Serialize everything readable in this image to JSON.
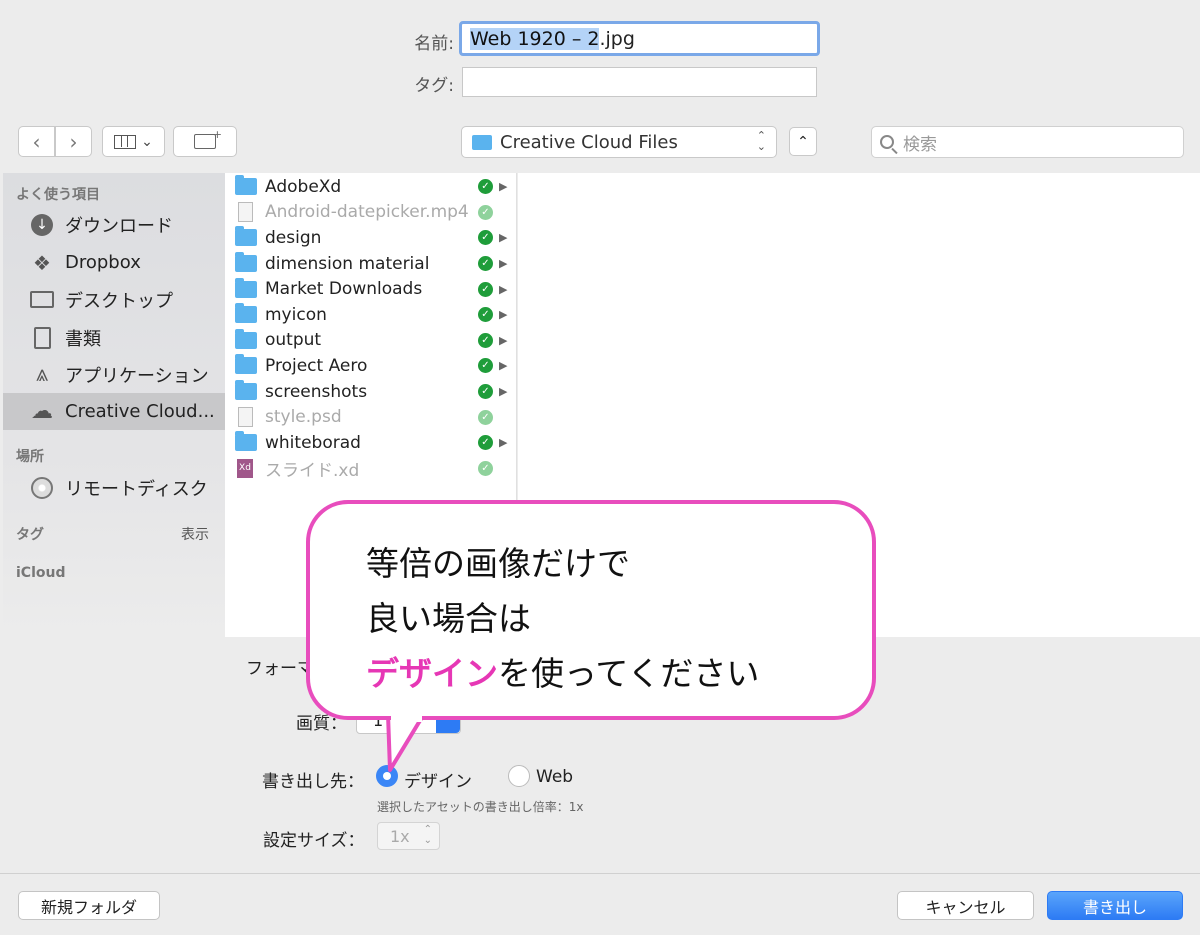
{
  "header": {
    "name_label": "名前:",
    "name_value_selected": "Web 1920 – 2",
    "name_value_ext": ".jpg",
    "tag_label": "タグ:",
    "tag_value": ""
  },
  "toolbar": {
    "location": "Creative Cloud Files",
    "search_placeholder": "検索"
  },
  "sidebar": {
    "favorites_header": "よく使う項目",
    "favorites": [
      {
        "label": "ダウンロード",
        "icon": "download-icon"
      },
      {
        "label": "Dropbox",
        "icon": "dropbox-icon"
      },
      {
        "label": "デスクトップ",
        "icon": "desktop-icon"
      },
      {
        "label": "書類",
        "icon": "documents-icon"
      },
      {
        "label": "アプリケーション",
        "icon": "applications-icon"
      },
      {
        "label": "Creative Cloud...",
        "icon": "creative-cloud-icon",
        "active": true
      }
    ],
    "places_header": "場所",
    "places": [
      {
        "label": "リモートディスク",
        "icon": "remote-disc-icon"
      }
    ],
    "tags_header": "タグ",
    "tags_show": "表示",
    "icloud_header": "iCloud"
  },
  "files": [
    {
      "name": "AdobeXd",
      "type": "folder",
      "synced": true,
      "dim": false,
      "expandable": true
    },
    {
      "name": "Android-datepicker.mp4",
      "type": "doc",
      "synced": true,
      "dim": true,
      "expandable": false
    },
    {
      "name": "design",
      "type": "folder",
      "synced": true,
      "dim": false,
      "expandable": true
    },
    {
      "name": "dimension material",
      "type": "folder",
      "synced": true,
      "dim": false,
      "expandable": true
    },
    {
      "name": "Market Downloads",
      "type": "folder",
      "synced": true,
      "dim": false,
      "expandable": true
    },
    {
      "name": "myicon",
      "type": "folder",
      "synced": true,
      "dim": false,
      "expandable": true
    },
    {
      "name": "output",
      "type": "folder",
      "synced": true,
      "dim": false,
      "expandable": true
    },
    {
      "name": "Project Aero",
      "type": "folder",
      "synced": true,
      "dim": false,
      "expandable": true
    },
    {
      "name": "screenshots",
      "type": "folder",
      "synced": true,
      "dim": false,
      "expandable": true
    },
    {
      "name": "style.psd",
      "type": "doc",
      "synced": true,
      "dim": true,
      "expandable": false
    },
    {
      "name": "whiteborad",
      "type": "folder",
      "synced": true,
      "dim": false,
      "expandable": true
    },
    {
      "name": "スライド.xd",
      "type": "xd",
      "synced": true,
      "dim": true,
      "expandable": false
    }
  ],
  "options": {
    "format_label_partial": "フォーマ",
    "quality_label": "画質：",
    "quality_value_partial": "1",
    "export_to_label": "書き出し先：",
    "radio_design": "デザイン",
    "radio_web": "Web",
    "selected": "デザイン",
    "note": "選択したアセットの書き出し倍率：1x",
    "size_label": "設定サイズ：",
    "size_value": "1x"
  },
  "callout": {
    "line1": "等倍の画像だけで",
    "line2": "良い場合は",
    "line3_highlight": "デザイン",
    "line3_rest": "を使ってください"
  },
  "buttons": {
    "new_folder": "新規フォルダ",
    "cancel": "キャンセル",
    "export": "書き出し"
  },
  "colors": {
    "accent": "#2d7bf4",
    "callout_border": "#e84dbd",
    "callout_highlight": "#e637b5",
    "sync_check": "#1f9d3a",
    "folder": "#5ab3ee"
  }
}
